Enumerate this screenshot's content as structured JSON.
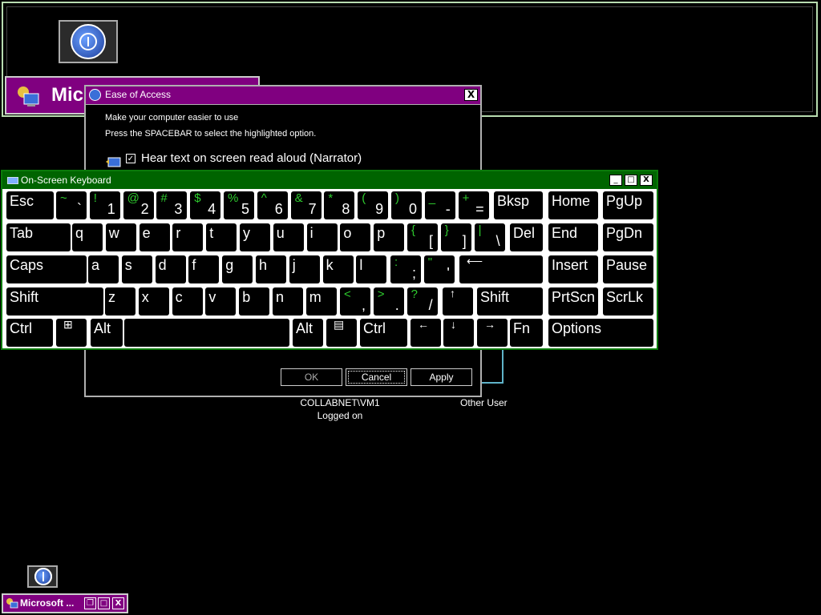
{
  "background_window": {
    "banner_text": "Micr"
  },
  "ease_dialog": {
    "title": "Ease of Access",
    "close_glyph": "X",
    "line1": "Make your computer easier to use",
    "line2": "Press the SPACEBAR to select the highlighted option.",
    "narrator_checkbox": "✓",
    "narrator_label": "Hear text on screen read aloud (Narrator)",
    "buttons": {
      "ok": "OK",
      "cancel": "Cancel",
      "apply": "Apply"
    }
  },
  "users": {
    "user1_name": "COLLABNET\\VM1",
    "user1_status": "Logged on",
    "user2_name": "Other User"
  },
  "osk": {
    "title": "On-Screen Keyboard",
    "min_glyph": "_",
    "max_glyph": "□",
    "close_glyph": "X",
    "keys": {
      "esc": "Esc",
      "bksp": "Bksp",
      "tab": "Tab",
      "del": "Del",
      "caps": "Caps",
      "enter": "⟵",
      "shift_l": "Shift",
      "shift_r": "Shift",
      "up": "↑",
      "ctrl_l": "Ctrl",
      "alt_l": "Alt",
      "alt_r": "Alt",
      "ctrl_r": "Ctrl",
      "left": "←",
      "down": "↓",
      "right": "→",
      "fn": "Fn",
      "home": "Home",
      "pgup": "PgUp",
      "end": "End",
      "pgdn": "PgDn",
      "insert": "Insert",
      "pause": "Pause",
      "prtscn": "PrtScn",
      "scrlk": "ScrLk",
      "options": "Options",
      "win": "⊞",
      "menu": "▤"
    },
    "row1": [
      {
        "shift": "~",
        "base": "`"
      },
      {
        "shift": "!",
        "base": "1"
      },
      {
        "shift": "@",
        "base": "2"
      },
      {
        "shift": "#",
        "base": "3"
      },
      {
        "shift": "$",
        "base": "4"
      },
      {
        "shift": "%",
        "base": "5"
      },
      {
        "shift": "^",
        "base": "6"
      },
      {
        "shift": "&",
        "base": "7"
      },
      {
        "shift": "*",
        "base": "8"
      },
      {
        "shift": "(",
        "base": "9"
      },
      {
        "shift": ")",
        "base": "0"
      },
      {
        "shift": "_",
        "base": "-"
      },
      {
        "shift": "+",
        "base": "="
      }
    ],
    "row2": [
      "q",
      "w",
      "e",
      "r",
      "t",
      "y",
      "u",
      "i",
      "o",
      "p"
    ],
    "row2_sym": [
      {
        "shift": "{",
        "base": "["
      },
      {
        "shift": "}",
        "base": "]"
      },
      {
        "shift": "|",
        "base": "\\"
      }
    ],
    "row3": [
      "a",
      "s",
      "d",
      "f",
      "g",
      "h",
      "j",
      "k",
      "l"
    ],
    "row3_sym": [
      {
        "shift": ":",
        "base": ";"
      },
      {
        "shift": "\"",
        "base": "'"
      }
    ],
    "row4": [
      "z",
      "x",
      "c",
      "v",
      "b",
      "n",
      "m"
    ],
    "row4_sym": [
      {
        "shift": "<",
        "base": ","
      },
      {
        "shift": ">",
        "base": "."
      },
      {
        "shift": "?",
        "base": "/"
      }
    ]
  },
  "taskbar": {
    "title": "Microsoft ...",
    "restore_glyph": "❐",
    "max_glyph": "□",
    "close_glyph": "X"
  },
  "colors": {
    "title_purple": "#800080",
    "title_green": "#006400",
    "shift_green": "#2ecc2e",
    "accent_cyan": "#5fb3c9"
  }
}
